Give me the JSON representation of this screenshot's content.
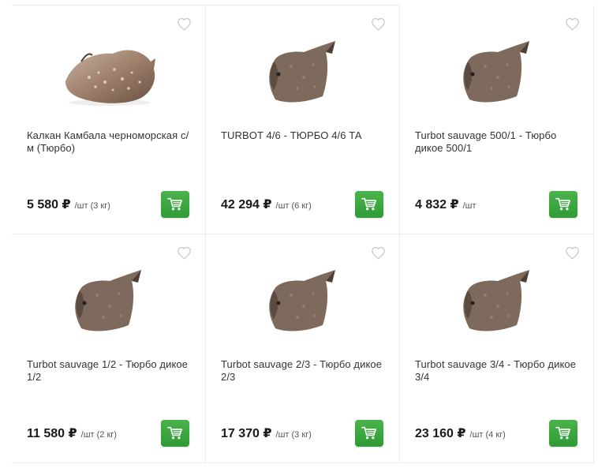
{
  "products": [
    {
      "title": "Калкан Камбала черноморская с/м (Тюрбо)",
      "price": "5 580 ₽",
      "unit": "/шт (3 кг)",
      "image": "whole-turbot-side"
    },
    {
      "title": "TURBOT 4/6 - ТЮРБО 4/6 ТА",
      "price": "42 294 ₽",
      "unit": "/шт (6 кг)",
      "image": "turbot-top"
    },
    {
      "title": "Turbot sauvage 500/1 - Тюрбо дикое 500/1",
      "price": "4 832 ₽",
      "unit": "/шт",
      "image": "turbot-top"
    },
    {
      "title": "Turbot sauvage 1/2 - Тюрбо дикое 1/2",
      "price": "11 580 ₽",
      "unit": "/шт (2 кг)",
      "image": "turbot-top"
    },
    {
      "title": "Turbot sauvage 2/3 - Тюрбо дикое 2/3",
      "price": "17 370 ₽",
      "unit": "/шт (3 кг)",
      "image": "turbot-top"
    },
    {
      "title": "Turbot sauvage 3/4 - Тюрбо дикое 3/4",
      "price": "23 160 ₽",
      "unit": "/шт (4 кг)",
      "image": "turbot-top"
    }
  ],
  "colors": {
    "cart_button": "#3aa83f",
    "heart_outline": "#c8c8c8",
    "card_border": "#ececec"
  },
  "icons": {
    "favorite": "heart-outline-icon",
    "cart": "shopping-cart-icon"
  }
}
